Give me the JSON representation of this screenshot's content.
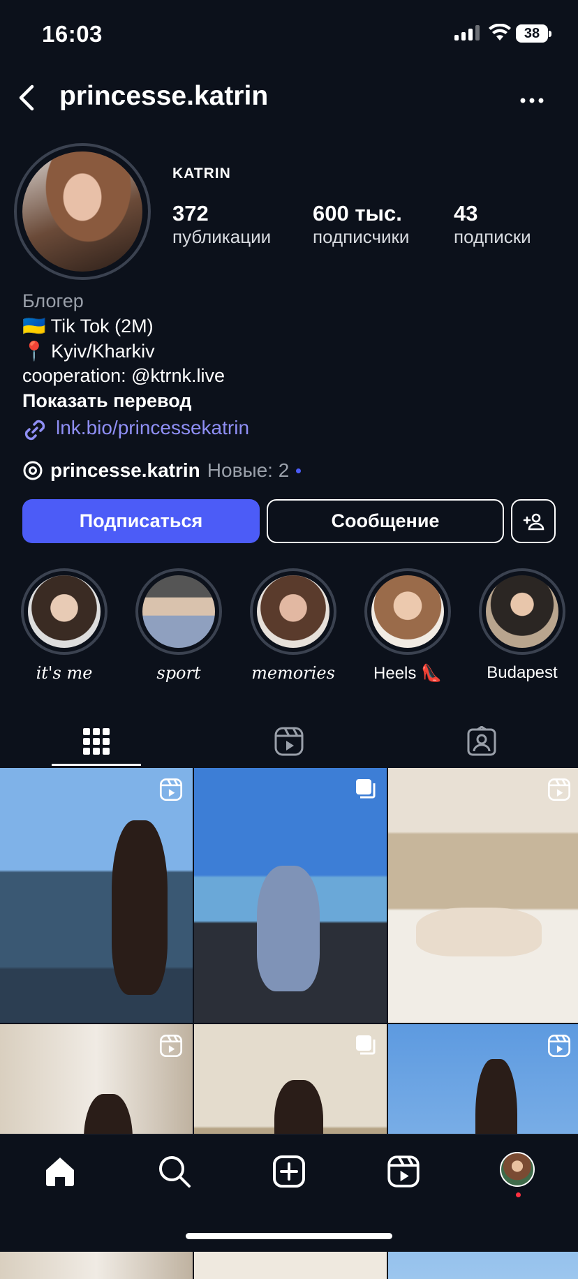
{
  "status_bar": {
    "time": "16:03",
    "battery": "38"
  },
  "header": {
    "username": "princesse.katrin",
    "back_icon": "chevron-left-icon",
    "more_icon": "ellipsis-icon"
  },
  "profile": {
    "display_name": "KATRIN",
    "stats": [
      {
        "value": "372",
        "label": "публикации"
      },
      {
        "value": "600 тыс.",
        "label": "подписчики"
      },
      {
        "value": "43",
        "label": "подписки"
      }
    ],
    "category": "Блогер",
    "bio_lines": [
      "🇺🇦 Tik Tok (2M)",
      "📍 Kyiv/Kharkiv",
      "cooperation: @ktrnk.live"
    ],
    "translate": "Показать перевод",
    "link": "lnk.bio/princessekatrin",
    "threads": {
      "handle": "princesse.katrin",
      "new": "Новые: 2"
    }
  },
  "actions": {
    "follow": "Подписаться",
    "message": "Сообщение"
  },
  "highlights": [
    {
      "title": "it's me",
      "color": "#d9b79e"
    },
    {
      "title": "sport",
      "color": "#b7a28c"
    },
    {
      "title": "memories",
      "color": "#c89a85"
    },
    {
      "title": "Heels 👠",
      "color": "#e2c3a6"
    },
    {
      "title": "Budapest",
      "color": "#8b7766"
    }
  ],
  "tabs": [
    {
      "name": "posts",
      "icon": "grid-icon",
      "active": true
    },
    {
      "name": "reels",
      "icon": "reels-icon",
      "active": false
    },
    {
      "name": "tagged",
      "icon": "tagged-user-icon",
      "active": false
    }
  ],
  "grid": [
    {
      "type": "reel",
      "icon": "reels-icon"
    },
    {
      "type": "carousel",
      "icon": "carousel-icon"
    },
    {
      "type": "reel",
      "icon": "reels-icon"
    },
    {
      "type": "reel",
      "icon": "reels-icon"
    },
    {
      "type": "carousel",
      "icon": "carousel-icon"
    },
    {
      "type": "reel",
      "icon": "reels-icon"
    }
  ],
  "bottom_nav": [
    "home-icon",
    "search-icon",
    "create-icon",
    "reels-icon",
    "profile-avatar"
  ],
  "colors": {
    "background": "#0c111b",
    "accent": "#4c5cf7",
    "link": "#8f8ff5",
    "notification": "#ff3040"
  }
}
